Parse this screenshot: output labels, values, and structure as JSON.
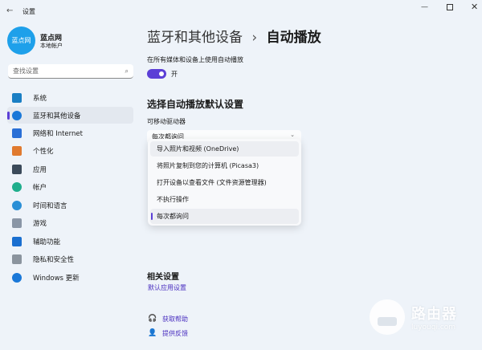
{
  "window": {
    "title": "设置",
    "controls": [
      "minimize",
      "maximize",
      "close"
    ]
  },
  "account": {
    "avatar_text": "蓝点网",
    "name": "蓝点网",
    "type": "本地帐户",
    "avatar_color": "#1ea0ea"
  },
  "search": {
    "placeholder": "查找设置"
  },
  "sidebar": {
    "items": [
      {
        "label": "系统",
        "icon": "monitor-icon",
        "color": "#1a7fc4"
      },
      {
        "label": "蓝牙和其他设备",
        "icon": "bluetooth-icon",
        "color": "#1a78d8",
        "selected": true
      },
      {
        "label": "网络和 Internet",
        "icon": "wifi-icon",
        "color": "#2a6fd6"
      },
      {
        "label": "个性化",
        "icon": "brush-icon",
        "color": "#e07a2f"
      },
      {
        "label": "应用",
        "icon": "apps-icon",
        "color": "#3b4a5a"
      },
      {
        "label": "帐户",
        "icon": "person-icon",
        "color": "#1fae8c"
      },
      {
        "label": "时间和语言",
        "icon": "globe-clock-icon",
        "color": "#2a8fd6"
      },
      {
        "label": "游戏",
        "icon": "gamepad-icon",
        "color": "#8a96a6"
      },
      {
        "label": "辅助功能",
        "icon": "accessibility-icon",
        "color": "#1a6fd0"
      },
      {
        "label": "隐私和安全性",
        "icon": "shield-icon",
        "color": "#8b949e"
      },
      {
        "label": "Windows 更新",
        "icon": "update-icon",
        "color": "#1a78d8"
      }
    ]
  },
  "breadcrumb": {
    "parent": "蓝牙和其他设备",
    "separator": "›",
    "current": "自动播放"
  },
  "autoplay": {
    "label": "在所有媒体和设备上使用自动播放",
    "toggle_on": true,
    "toggle_text": "开",
    "accent": "#5b3fd6"
  },
  "defaults": {
    "heading": "选择自动播放默认设置",
    "drive_label": "可移动驱动器",
    "selected": "每次都询问",
    "options": [
      "导入照片和视频 (OneDrive)",
      "将照片复制到您的计算机 (Picasa3)",
      "打开设备以查看文件 (文件资源管理器)",
      "不执行操作",
      "每次都询问"
    ]
  },
  "related": {
    "heading": "相关设置",
    "link": "默认应用设置"
  },
  "footer": {
    "help": "获取帮助",
    "feedback": "提供反馈"
  },
  "watermark": {
    "title": "路由器",
    "url": "luyouqi.com"
  }
}
